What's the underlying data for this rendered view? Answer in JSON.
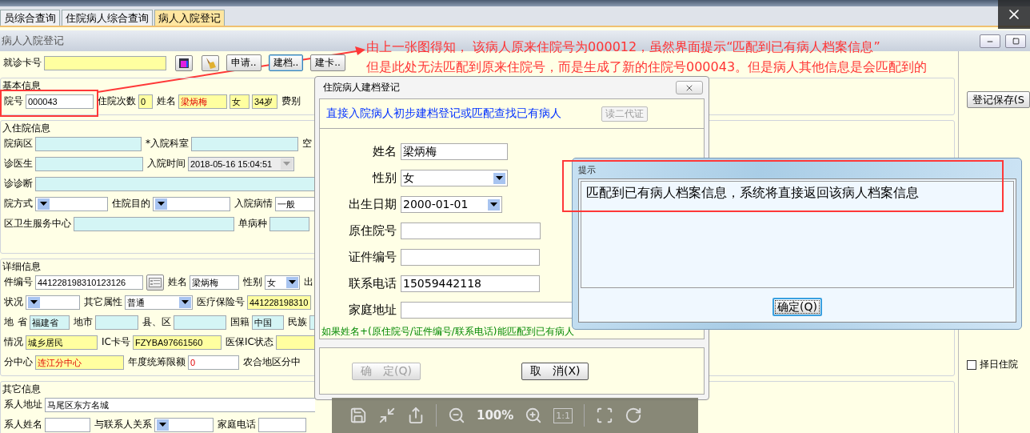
{
  "tabs": [
    {
      "label": "员综合查询",
      "selected": false
    },
    {
      "label": "住院病人综合查询",
      "selected": false
    },
    {
      "label": "病人入院登记",
      "selected": true
    }
  ],
  "form": {
    "title": "病人入院登记",
    "toolbar": [
      {
        "kind": "label",
        "text": "就诊卡号"
      },
      {
        "kind": "input",
        "color": "#ffffa0"
      },
      {
        "kind": "reader"
      },
      {
        "kind": "broom"
      },
      {
        "kind": "button",
        "text": "申请..",
        "focused": false
      },
      {
        "kind": "button",
        "text": "建档..",
        "focused": true
      },
      {
        "kind": "button",
        "text": "建卡..",
        "focused": false
      }
    ],
    "sections": [
      {
        "legend": "基本信息",
        "lines": [
          {
            "items": [
              {
                "kind": "label",
                "text": "院号"
              },
              {
                "kind": "input",
                "value": "000043",
                "color": "#ffffff",
                "alert": false
              },
              {
                "kind": "label",
                "text": "住院次数"
              },
              {
                "kind": "input",
                "value": "0",
                "color": "#ffffa0",
                "alert": false
              },
              {
                "kind": "label",
                "text": "姓名"
              },
              {
                "kind": "input",
                "value": "梁炳梅",
                "color": "#ffffa0",
                "alert": true
              },
              {
                "kind": "input",
                "value": "女",
                "color": "#ffffa0",
                "alert": false
              },
              {
                "kind": "input",
                "value": "34岁",
                "color": "#ffffa0",
                "alert": false
              },
              {
                "kind": "label",
                "text": "费别"
              }
            ]
          }
        ]
      },
      {
        "legend": "入住院信息",
        "lines": [
          {
            "items": [
              {
                "kind": "label",
                "text": "院病区"
              },
              {
                "kind": "input",
                "color": "#d4f5f5"
              },
              {
                "kind": "label",
                "text": "*入院科室"
              },
              {
                "kind": "input",
                "color": "#d4f5f5"
              },
              {
                "kind": "label",
                "text": "空"
              }
            ]
          },
          {
            "items": [
              {
                "kind": "label",
                "text": "诊医生"
              },
              {
                "kind": "input",
                "color": "#d4f5f5"
              },
              {
                "kind": "label",
                "text": "入院时间"
              },
              {
                "kind": "select",
                "value": "2018-05-16 15:04:51",
                "color": "#ececec",
                "alert": false
              }
            ]
          },
          {
            "items": [
              {
                "kind": "label",
                "text": "诊诊断"
              },
              {
                "kind": "input",
                "color": "#d4f5f5"
              }
            ]
          },
          {
            "items": [
              {
                "kind": "label",
                "text": "院方式"
              },
              {
                "kind": "select",
                "color": "#ffffff"
              },
              {
                "kind": "label",
                "text": "住院目的"
              },
              {
                "kind": "select",
                "color": "#ffffff"
              },
              {
                "kind": "label",
                "text": "入院病情"
              },
              {
                "kind": "input",
                "value": "一般",
                "color": "#ffffff",
                "alert": false
              }
            ]
          },
          {
            "items": [
              {
                "kind": "label",
                "text": "区卫生服务中心"
              },
              {
                "kind": "input",
                "color": "#d4f5f5"
              },
              {
                "kind": "label",
                "text": "单病种"
              },
              {
                "kind": "input",
                "color": "#d4f5f5"
              }
            ]
          }
        ]
      },
      {
        "legend": "详细信息",
        "lines": [
          {
            "items": [
              {
                "kind": "label",
                "text": "件编号"
              },
              {
                "kind": "input",
                "value": "441228198310123126",
                "color": "#ffffff",
                "alert": false
              },
              {
                "kind": "idcard"
              },
              {
                "kind": "label",
                "text": "姓名"
              },
              {
                "kind": "input",
                "value": "梁炳梅",
                "color": "#ffffff",
                "alert": false
              },
              {
                "kind": "label",
                "text": "性别"
              },
              {
                "kind": "select",
                "value": "女",
                "color": "#ffffff",
                "alert": false
              },
              {
                "kind": "label",
                "text": "出"
              }
            ]
          },
          {
            "items": [
              {
                "kind": "label",
                "text": "状况"
              },
              {
                "kind": "select",
                "color": "#ffffff"
              },
              {
                "kind": "label",
                "text": "其它属性"
              },
              {
                "kind": "select",
                "value": "普通",
                "color": "#ffffff",
                "alert": false
              },
              {
                "kind": "label",
                "text": "医疗保险号"
              },
              {
                "kind": "input",
                "value": "441228198310",
                "color": "#ffffa0",
                "alert": false
              }
            ]
          },
          {
            "items": [
              {
                "kind": "label",
                "text": "地"
              },
              {
                "kind": "label",
                "text": "省"
              },
              {
                "kind": "input",
                "value": "福建省",
                "color": "#d4f5f5",
                "alert": false
              },
              {
                "kind": "label",
                "text": "地市"
              },
              {
                "kind": "input",
                "color": "#d4f5f5"
              },
              {
                "kind": "label",
                "text": "县、区"
              },
              {
                "kind": "input",
                "color": "#d4f5f5"
              },
              {
                "kind": "label",
                "text": "国籍"
              },
              {
                "kind": "input",
                "value": "中国",
                "color": "#d4f5f5",
                "alert": false
              },
              {
                "kind": "label",
                "text": "民族"
              },
              {
                "kind": "input",
                "color": "#d4f5f5"
              }
            ]
          },
          {
            "items": [
              {
                "kind": "label",
                "text": "情况"
              },
              {
                "kind": "input",
                "value": "城乡居民",
                "color": "#ffffa0",
                "alert": false
              },
              {
                "kind": "label",
                "text": "IC卡号"
              },
              {
                "kind": "input",
                "value": "FZYBA97661560",
                "color": "#ffffa0",
                "alert": false
              },
              {
                "kind": "label",
                "text": "医保IC状态"
              },
              {
                "kind": "input",
                "color": "#ffffa0"
              }
            ]
          },
          {
            "items": [
              {
                "kind": "label",
                "text": "分中心"
              },
              {
                "kind": "input",
                "value": "连江分中心",
                "color": "#ffffa0",
                "alert": true
              },
              {
                "kind": "label",
                "text": "年度统筹限额"
              },
              {
                "kind": "input",
                "value": "0",
                "color": "#ffffff",
                "alert": true
              },
              {
                "kind": "label",
                "text": "农合地区分中"
              }
            ]
          }
        ]
      },
      {
        "legend": "其它信息",
        "lines": [
          {
            "items": [
              {
                "kind": "label",
                "text": "系人地址"
              },
              {
                "kind": "input",
                "value": "马尾区东方名城",
                "color": "#ffffff",
                "alert": false
              }
            ]
          },
          {
            "items": [
              {
                "kind": "label",
                "text": "系人姓名"
              },
              {
                "kind": "input",
                "color": "#ffffff"
              },
              {
                "kind": "label",
                "text": "与联系人关系"
              },
              {
                "kind": "select",
                "color": "#ffffff"
              },
              {
                "kind": "label",
                "text": "家庭电话"
              },
              {
                "kind": "input",
                "color": "#ffffff"
              }
            ]
          }
        ]
      }
    ],
    "save_button": "登记保存(S",
    "schedule_checkbox": {
      "label": "择日住院",
      "checked": false
    }
  },
  "annotation": {
    "lines": [
      "由上一张图得知，  该病人原来住院号为000012，虽然界面提示“匹配到已有病人档案信息”",
      "但是此处无法匹配到原来住院号，而是生成了新的住院号000043。但是病人其他信息是会匹配到的"
    ]
  },
  "archive_dialog": {
    "title": "住院病人建档登记",
    "heading": "直接入院病人初步建档登记或匹配查找已有病人",
    "id_button": {
      "label": "读二代证",
      "disabled": true
    },
    "fields": [
      {
        "label": "姓名",
        "value": "梁炳梅",
        "kind": "input"
      },
      {
        "label": "性别",
        "value": "女",
        "kind": "select"
      },
      {
        "label": "出生日期",
        "value": "2000-01-01",
        "kind": "select"
      },
      {
        "label": "原住院号",
        "kind": "input"
      },
      {
        "label": "证件编号",
        "kind": "input"
      },
      {
        "label": "联系电话",
        "value": "15059442118",
        "kind": "input"
      },
      {
        "label": "家庭地址",
        "kind": "input"
      }
    ],
    "hint": "如果姓名+(原住院号/证件编号/联系电话)能匹配到已有病人",
    "buttons": [
      {
        "label": "确　定(Q)",
        "disabled": true
      },
      {
        "label": "取　消(X)",
        "disabled": false
      }
    ]
  },
  "prompt_dialog": {
    "title": "提示",
    "message": "匹配到已有病人档案信息，系统将直接返回该病人档案信息",
    "button": "确定(Q)"
  },
  "viewer_toolbar": {
    "zoom": "100%",
    "actual_size": "1:1"
  }
}
